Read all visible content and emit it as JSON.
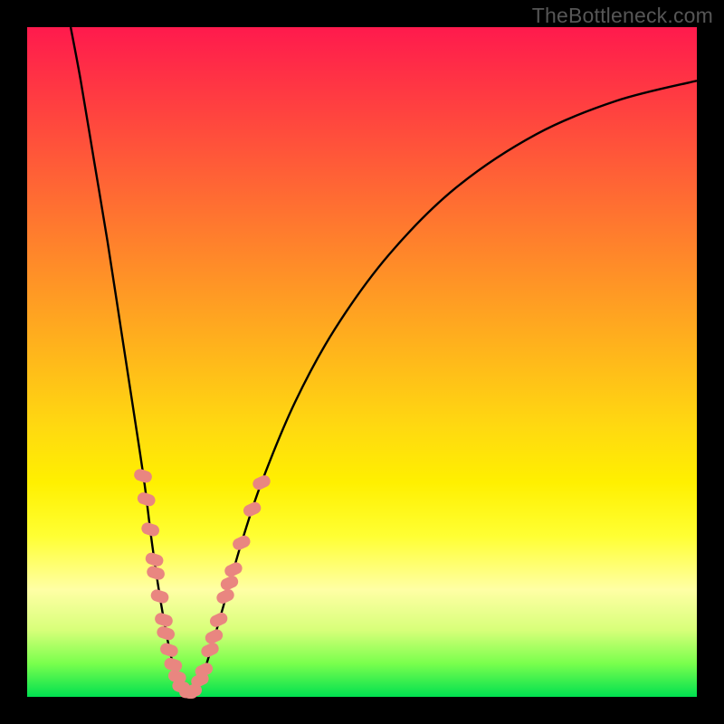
{
  "watermark": "TheBottleneck.com",
  "colors": {
    "frame": "#000000",
    "curve": "#000000",
    "marker_fill": "#e98680",
    "marker_stroke": "#e98680"
  },
  "chart_data": {
    "type": "line",
    "title": "",
    "xlabel": "",
    "ylabel": "",
    "xlim": [
      0,
      100
    ],
    "ylim": [
      0,
      100
    ],
    "curve_note": "V-shaped bottleneck curve; minimum near x≈23, y≈0; left branch steep, right branch shallower asymptote",
    "curve_points": [
      {
        "x": 6.5,
        "y": 100
      },
      {
        "x": 8,
        "y": 92
      },
      {
        "x": 10,
        "y": 80
      },
      {
        "x": 12,
        "y": 68
      },
      {
        "x": 14,
        "y": 55
      },
      {
        "x": 16,
        "y": 42
      },
      {
        "x": 17.5,
        "y": 32
      },
      {
        "x": 18.5,
        "y": 24
      },
      {
        "x": 19.5,
        "y": 17
      },
      {
        "x": 20.5,
        "y": 11
      },
      {
        "x": 21.5,
        "y": 6
      },
      {
        "x": 22.5,
        "y": 2.5
      },
      {
        "x": 23.5,
        "y": 0.8
      },
      {
        "x": 24.5,
        "y": 0.6
      },
      {
        "x": 25.5,
        "y": 1.5
      },
      {
        "x": 26.5,
        "y": 4
      },
      {
        "x": 28,
        "y": 9
      },
      {
        "x": 30,
        "y": 16
      },
      {
        "x": 32,
        "y": 23
      },
      {
        "x": 35,
        "y": 32
      },
      {
        "x": 40,
        "y": 44
      },
      {
        "x": 46,
        "y": 55
      },
      {
        "x": 54,
        "y": 66
      },
      {
        "x": 64,
        "y": 76
      },
      {
        "x": 76,
        "y": 84
      },
      {
        "x": 88,
        "y": 89
      },
      {
        "x": 100,
        "y": 92
      }
    ],
    "markers_left": [
      {
        "x": 17.3,
        "y": 33
      },
      {
        "x": 17.8,
        "y": 29.5
      },
      {
        "x": 18.4,
        "y": 25
      },
      {
        "x": 19.0,
        "y": 20.5
      },
      {
        "x": 19.2,
        "y": 18.5
      },
      {
        "x": 19.8,
        "y": 15
      },
      {
        "x": 20.4,
        "y": 11.5
      },
      {
        "x": 20.7,
        "y": 9.5
      },
      {
        "x": 21.2,
        "y": 7
      },
      {
        "x": 21.8,
        "y": 4.8
      },
      {
        "x": 22.4,
        "y": 3
      },
      {
        "x": 23.0,
        "y": 1.5
      }
    ],
    "markers_bottom": [
      {
        "x": 23.8,
        "y": 0.7
      },
      {
        "x": 24.4,
        "y": 0.6
      },
      {
        "x": 25.0,
        "y": 1.0
      }
    ],
    "markers_right": [
      {
        "x": 25.8,
        "y": 2.5
      },
      {
        "x": 26.4,
        "y": 4
      },
      {
        "x": 27.3,
        "y": 7
      },
      {
        "x": 27.9,
        "y": 9
      },
      {
        "x": 28.6,
        "y": 11.5
      },
      {
        "x": 29.6,
        "y": 15
      },
      {
        "x": 30.2,
        "y": 17
      },
      {
        "x": 30.8,
        "y": 19
      },
      {
        "x": 32.0,
        "y": 23
      },
      {
        "x": 33.6,
        "y": 28
      },
      {
        "x": 35.0,
        "y": 32
      }
    ]
  }
}
